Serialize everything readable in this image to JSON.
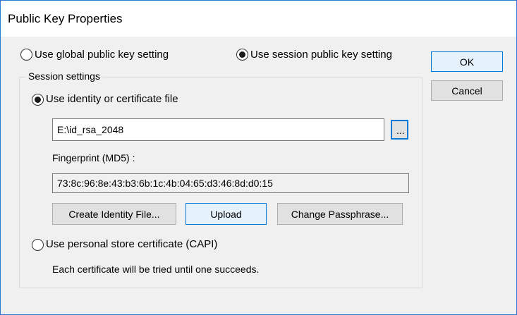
{
  "dialog": {
    "title": "Public Key Properties"
  },
  "scope": {
    "global_label": "Use global public key setting",
    "session_label": "Use session public key setting",
    "selected": "session"
  },
  "buttons": {
    "ok": "OK",
    "cancel": "Cancel"
  },
  "session_settings": {
    "legend": "Session settings",
    "identity_option": "Use identity or certificate file",
    "identity_path": "E:\\id_rsa_2048",
    "browse_label": "...",
    "fingerprint_label": "Fingerprint (MD5) :",
    "fingerprint_value": "73:8c:96:8e:43:b3:6b:1c:4b:04:65:d3:46:8d:d0:15",
    "create_identity": "Create Identity File...",
    "upload": "Upload",
    "change_passphrase": "Change Passphrase...",
    "capi_option": "Use personal store certificate (CAPI)",
    "note": "Each certificate will be tried until one succeeds.",
    "selected": "identity"
  },
  "colors": {
    "accent": "#0078d7",
    "window_border": "#2b79d0",
    "dialog_bg": "#f0f0f0"
  }
}
